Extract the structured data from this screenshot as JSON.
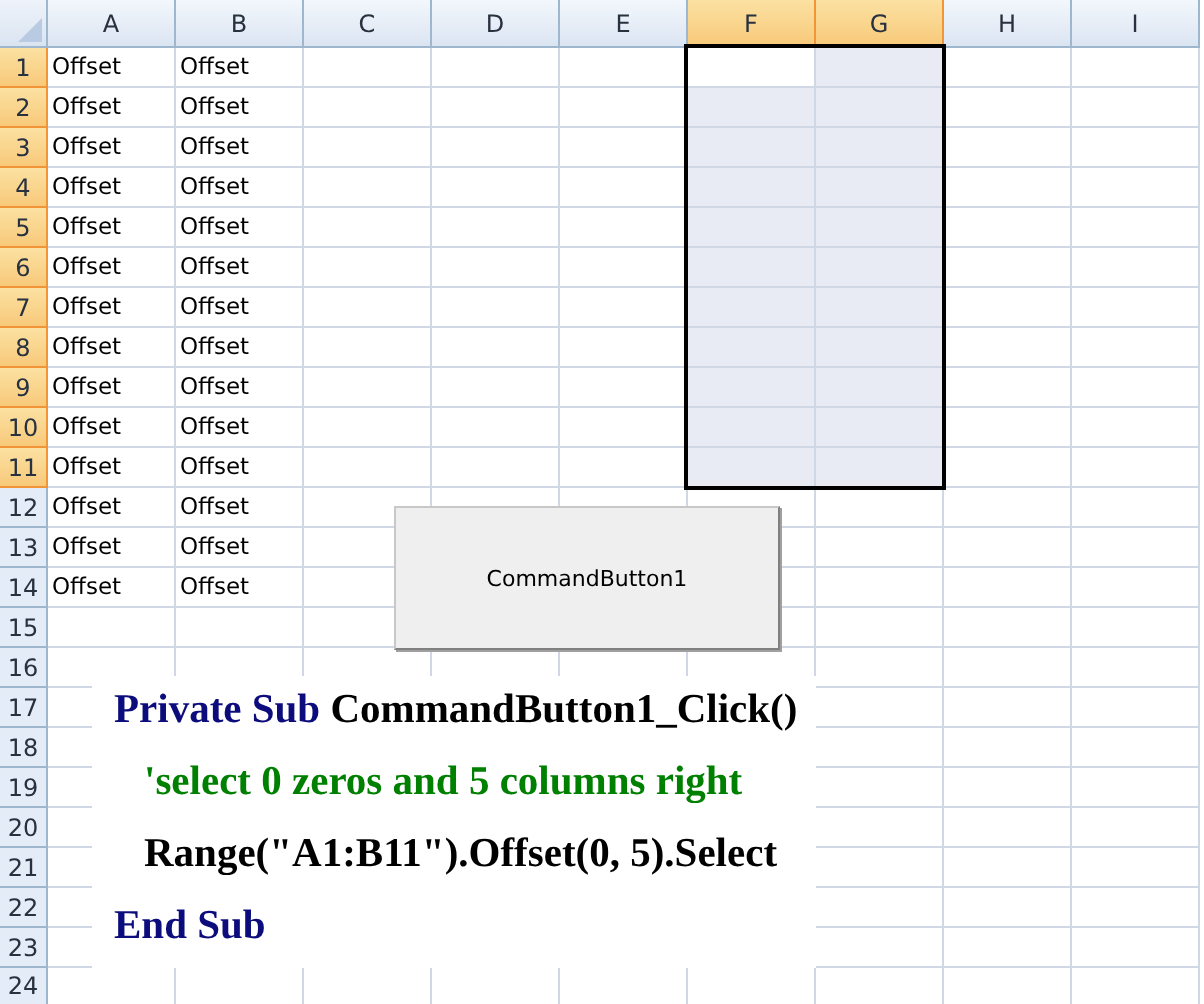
{
  "sheet": {
    "columns": [
      {
        "label": "A",
        "selected": false
      },
      {
        "label": "B",
        "selected": false
      },
      {
        "label": "C",
        "selected": false
      },
      {
        "label": "D",
        "selected": false
      },
      {
        "label": "E",
        "selected": false
      },
      {
        "label": "F",
        "selected": true
      },
      {
        "label": "G",
        "selected": true
      },
      {
        "label": "H",
        "selected": false
      },
      {
        "label": "I",
        "selected": false
      }
    ],
    "rows": [
      {
        "number": "1",
        "selected": true,
        "values": [
          "Offset",
          "Offset"
        ]
      },
      {
        "number": "2",
        "selected": true,
        "values": [
          "Offset",
          "Offset"
        ]
      },
      {
        "number": "3",
        "selected": true,
        "values": [
          "Offset",
          "Offset"
        ]
      },
      {
        "number": "4",
        "selected": true,
        "values": [
          "Offset",
          "Offset"
        ]
      },
      {
        "number": "5",
        "selected": true,
        "values": [
          "Offset",
          "Offset"
        ]
      },
      {
        "number": "6",
        "selected": true,
        "values": [
          "Offset",
          "Offset"
        ]
      },
      {
        "number": "7",
        "selected": true,
        "values": [
          "Offset",
          "Offset"
        ]
      },
      {
        "number": "8",
        "selected": true,
        "values": [
          "Offset",
          "Offset"
        ]
      },
      {
        "number": "9",
        "selected": true,
        "values": [
          "Offset",
          "Offset"
        ]
      },
      {
        "number": "10",
        "selected": true,
        "values": [
          "Offset",
          "Offset"
        ]
      },
      {
        "number": "11",
        "selected": true,
        "values": [
          "Offset",
          "Offset"
        ]
      },
      {
        "number": "12",
        "selected": false,
        "values": [
          "Offset",
          "Offset"
        ]
      },
      {
        "number": "13",
        "selected": false,
        "values": [
          "Offset",
          "Offset"
        ]
      },
      {
        "number": "14",
        "selected": false,
        "values": [
          "Offset",
          "Offset"
        ]
      },
      {
        "number": "15",
        "selected": false
      },
      {
        "number": "16",
        "selected": false
      },
      {
        "number": "17",
        "selected": false
      },
      {
        "number": "18",
        "selected": false
      },
      {
        "number": "19",
        "selected": false
      },
      {
        "number": "20",
        "selected": false
      },
      {
        "number": "21",
        "selected": false
      },
      {
        "number": "22",
        "selected": false
      },
      {
        "number": "23",
        "selected": false
      },
      {
        "number": "24",
        "selected": false
      }
    ]
  },
  "command_button": {
    "label": "CommandButton1"
  },
  "code": [
    {
      "kind": "declaration",
      "segments": [
        {
          "kind": "keyword",
          "text": "Private Sub"
        },
        {
          "kind": "plain",
          "text": "CommandButton1_Click()"
        }
      ]
    },
    {
      "kind": "statement",
      "segments": [
        {
          "kind": "comment",
          "text": "'select 0 zeros and 5 columns right"
        }
      ]
    },
    {
      "kind": "statement",
      "segments": [
        {
          "kind": "plain",
          "text": "Range(\"A1:B11\").Offset(0, 5).Select"
        }
      ]
    },
    {
      "kind": "declaration",
      "segments": [
        {
          "kind": "keyword",
          "text": "End Sub"
        }
      ]
    }
  ]
}
